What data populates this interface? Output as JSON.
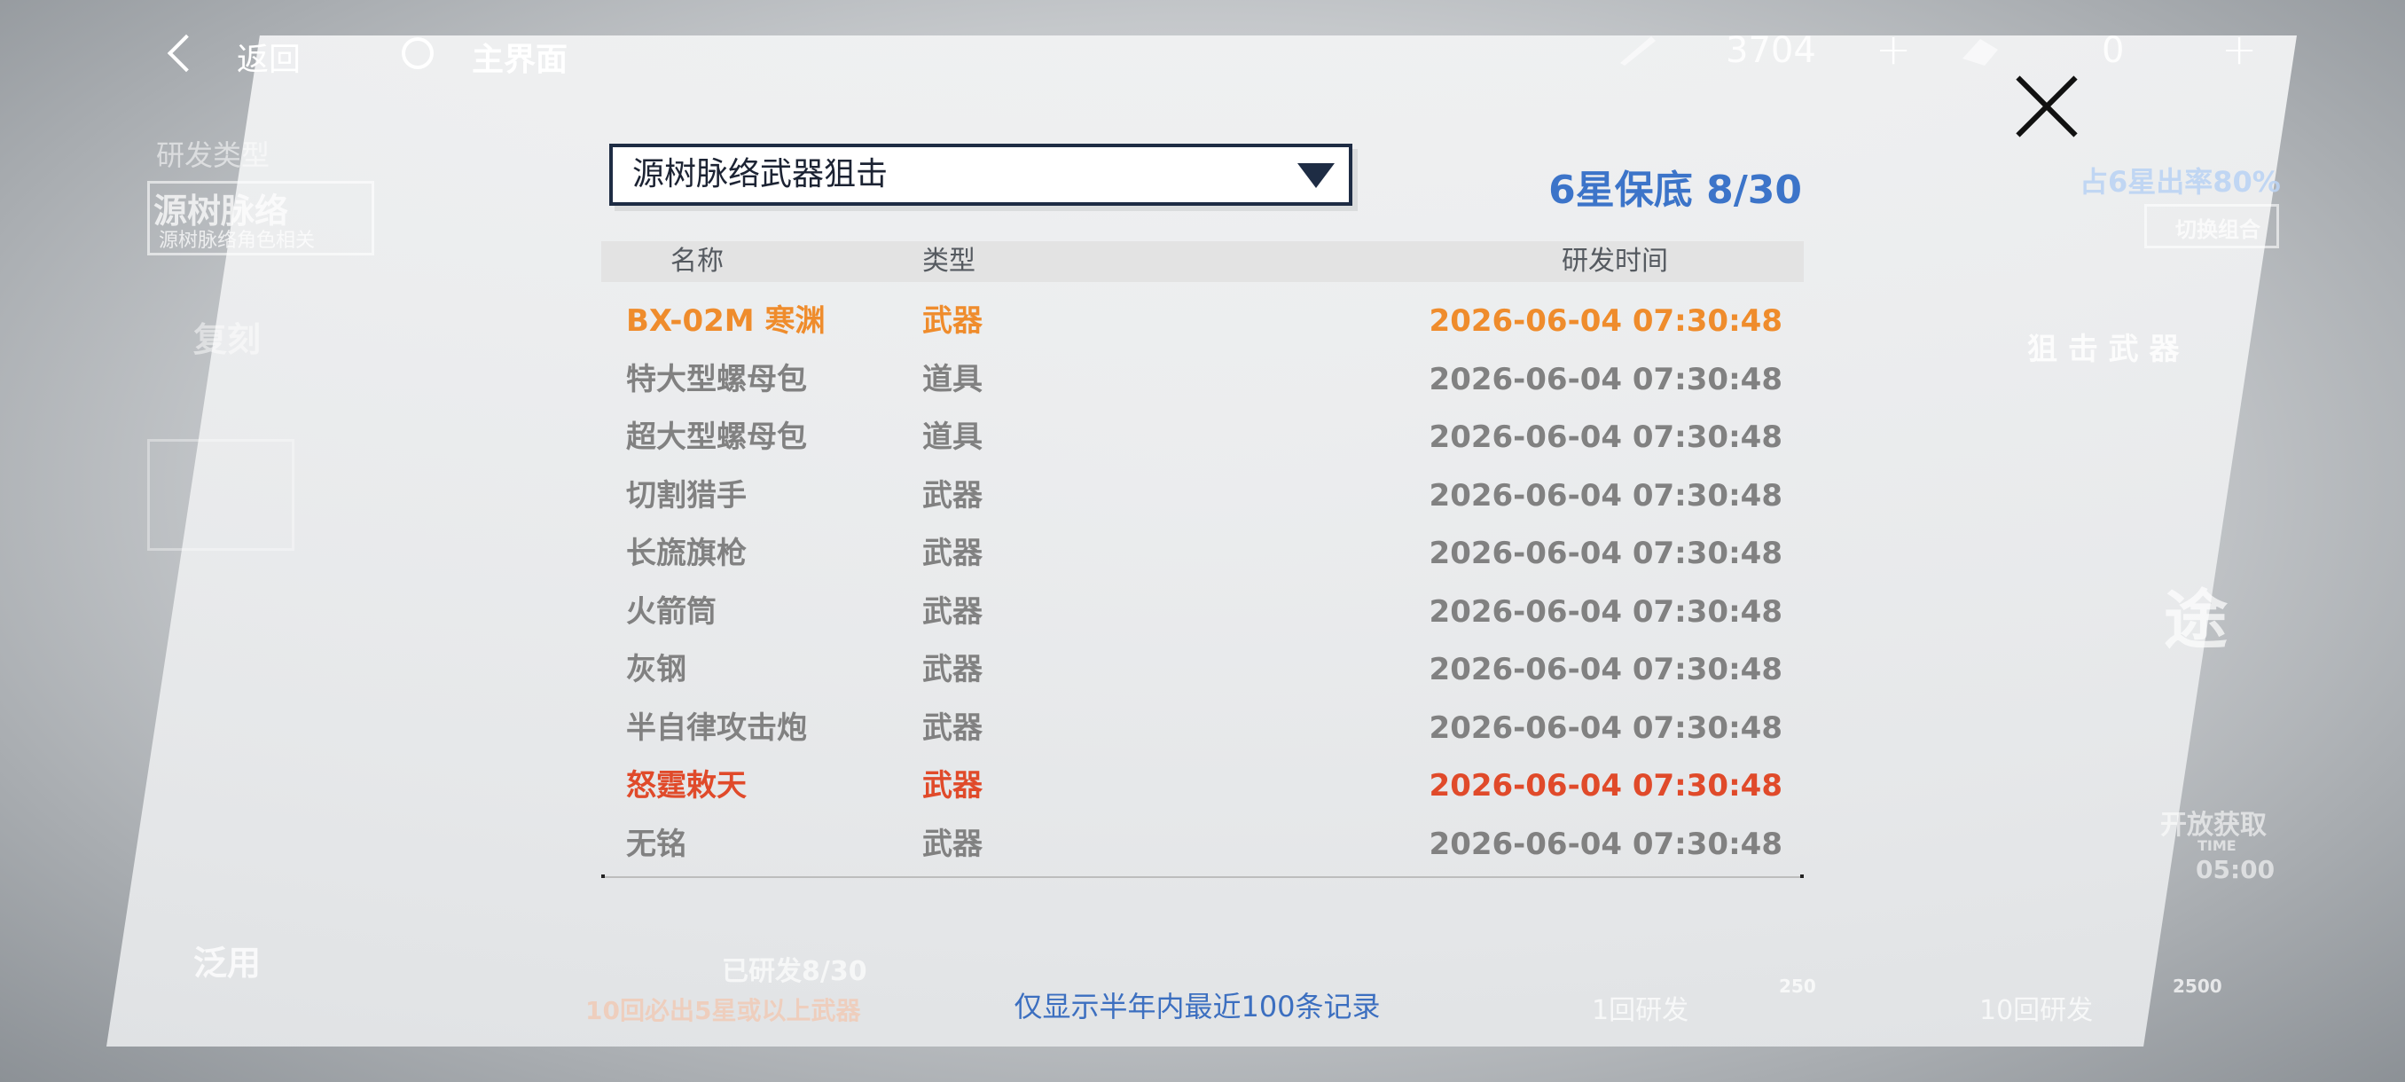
{
  "colors": {
    "accent_blue": "#3c74c9",
    "rarity_5_orange": "#ef8c2c",
    "rarity_6_red": "#e04a2a",
    "normal_gray": "#818181"
  },
  "topbar": {
    "back_label": "返回",
    "home_label": "主界面",
    "currency_1_value": "3704",
    "currency_2_value": "0",
    "plus_label": "+"
  },
  "background": {
    "category_label": "研发类型",
    "category_value": "源树脉络",
    "category_sub": "源树脉络角色相关",
    "left_item_1": "复刻",
    "left_item_2": "泛用",
    "right_rate": "占6星出率80%",
    "right_switch": "切换组合",
    "right_tag": "狙 击 武 器",
    "right_char": "途",
    "right_open": "开放获取",
    "right_time_label": "TIME",
    "right_time": "05:00",
    "bottom_left_1": "已研发8/30",
    "bottom_left_2": "10回必出5星或以上武器",
    "bottom_pull_1": "1回研发",
    "bottom_pull_1_cost": "250",
    "bottom_pull_10": "10回研发",
    "bottom_pull_10_cost": "2500"
  },
  "modal": {
    "pool_selected": "源树脉络武器狙击",
    "pity_text": "6星保底 8/30",
    "columns": {
      "name": "名称",
      "type": "类型",
      "time": "研发时间"
    },
    "records": [
      {
        "name": "BX-02M 寒渊",
        "type": "武器",
        "time": "2026-06-04 07:30:48",
        "rarity": "orange"
      },
      {
        "name": "特大型螺母包",
        "type": "道具",
        "time": "2026-06-04 07:30:48",
        "rarity": "normal"
      },
      {
        "name": "超大型螺母包",
        "type": "道具",
        "time": "2026-06-04 07:30:48",
        "rarity": "normal"
      },
      {
        "name": "切割猎手",
        "type": "武器",
        "time": "2026-06-04 07:30:48",
        "rarity": "normal"
      },
      {
        "name": "长旒旗枪",
        "type": "武器",
        "time": "2026-06-04 07:30:48",
        "rarity": "normal"
      },
      {
        "name": "火箭筒",
        "type": "武器",
        "time": "2026-06-04 07:30:48",
        "rarity": "normal"
      },
      {
        "name": "灰钢",
        "type": "武器",
        "time": "2026-06-04 07:30:48",
        "rarity": "normal"
      },
      {
        "name": "半自律攻击炮",
        "type": "武器",
        "time": "2026-06-04 07:30:48",
        "rarity": "normal"
      },
      {
        "name": "怒霆敕天",
        "type": "武器",
        "time": "2026-06-04 07:30:48",
        "rarity": "red"
      },
      {
        "name": "无铭",
        "type": "武器",
        "time": "2026-06-04 07:30:48",
        "rarity": "normal"
      }
    ],
    "footer_note": "仅显示半年内最近100条记录"
  }
}
